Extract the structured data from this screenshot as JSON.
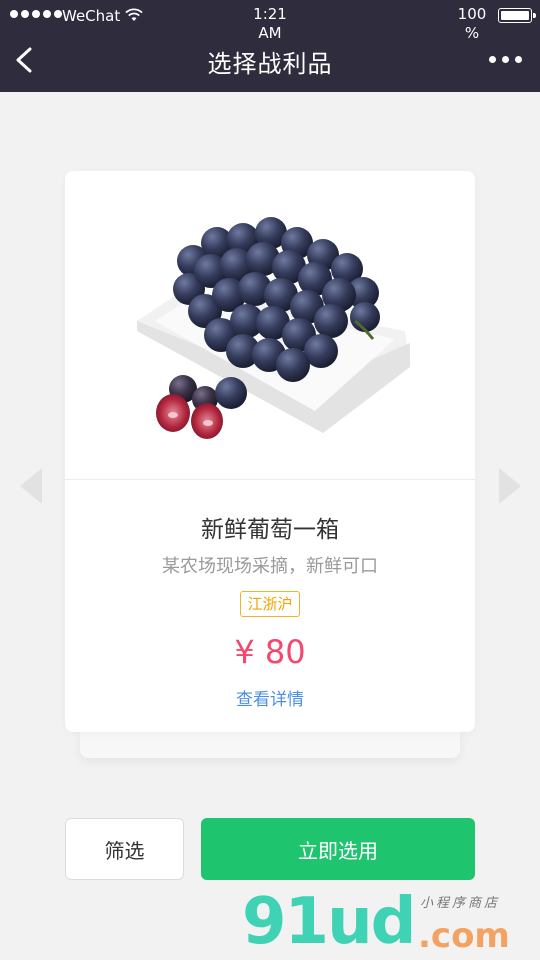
{
  "status_bar": {
    "carrier": "WeChat",
    "time": "1:21 AM",
    "battery": "100 %"
  },
  "nav": {
    "title": "选择战利品"
  },
  "product": {
    "name": "新鲜葡萄一箱",
    "description": "某农场现场采摘，新鲜可口",
    "region": "江浙沪",
    "price": "¥ 80",
    "detail_link": "查看详情"
  },
  "actions": {
    "filter_label": "筛选",
    "select_label": "立即选用"
  },
  "watermark": {
    "main": "91ud",
    "domain": ".com",
    "tagline": "小程序商店"
  },
  "colors": {
    "nav_bg": "#2e2c3d",
    "price": "#f4486d",
    "link": "#4a90e2",
    "region": "#f0a400",
    "primary_button": "#1fc46e"
  }
}
